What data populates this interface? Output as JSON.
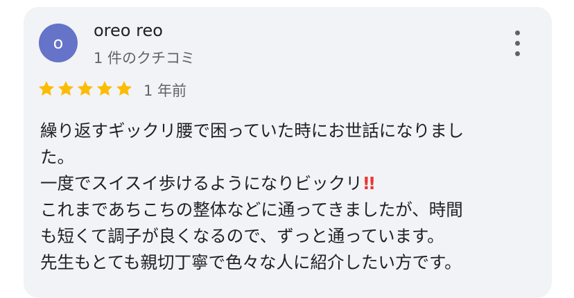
{
  "review": {
    "avatar_letter": "o",
    "avatar_color": "#6573c8",
    "author_name": "oreo reo",
    "review_count": "1 件のクチコミ",
    "rating": 5,
    "rating_max": 5,
    "star_color": "#fbbc04",
    "date": "1 年前",
    "text_lines": [
      "繰り返すギックリ腰で困っていた時にお世話になりまし",
      "た。",
      "一度でスイスイ歩けるようになりビックリ",
      "これまであちこちの整体などに通ってきましたが、時間",
      "も短くて調子が良くなるので、ずっと通っています。",
      "先生もとても親切丁寧で色々な人に紹介したい方です。"
    ],
    "emphasis_emoji": "!!",
    "menu_icon": "more-vert-icon"
  }
}
